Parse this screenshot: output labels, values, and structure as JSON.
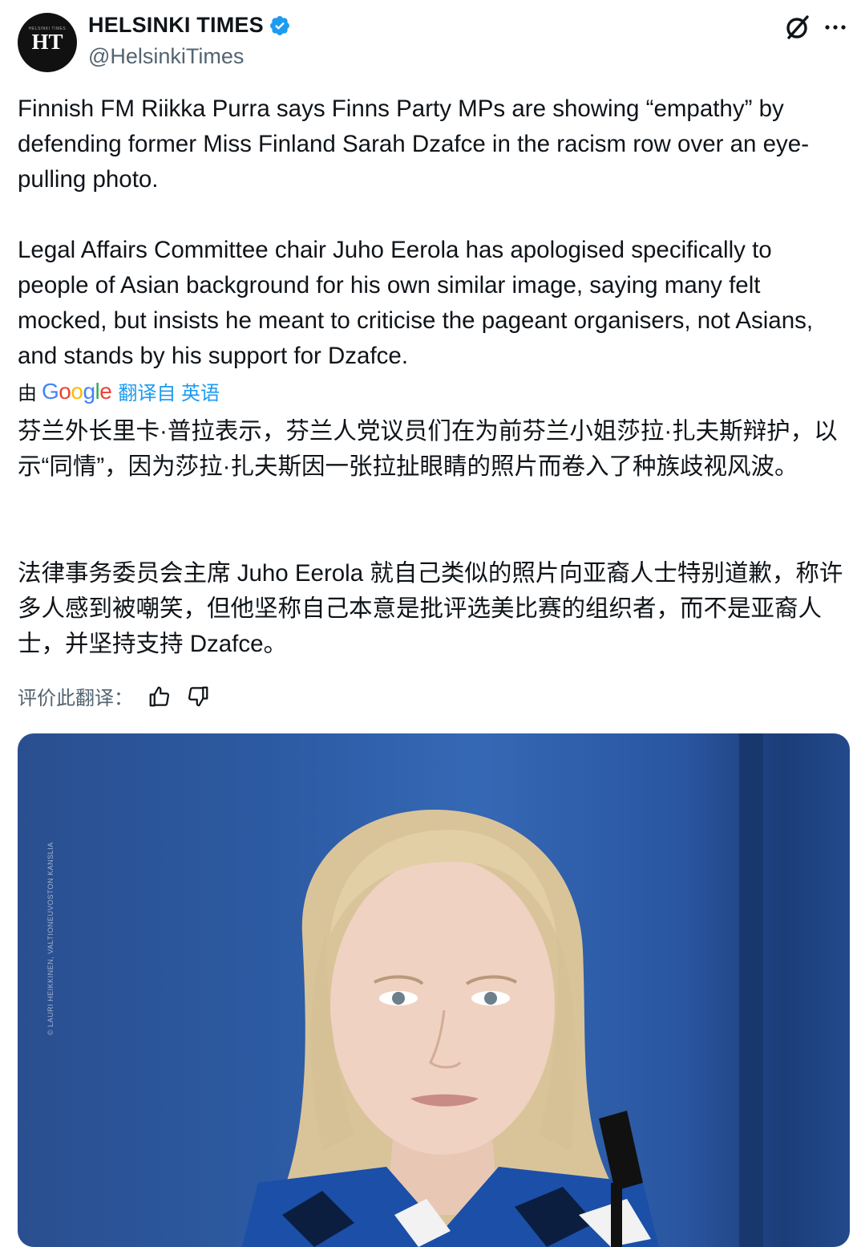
{
  "account": {
    "avatar_text": "HT",
    "avatar_small_text": "HELSINKI TIMES",
    "display_name": "HELSINKI TIMES",
    "handle": "@HelsinkiTimes",
    "verified_color": "#1d9bf0"
  },
  "post": {
    "paragraph_1": "Finnish FM Riikka Purra says Finns Party MPs are showing “empathy” by defending former Miss Finland Sarah Dzafce in the racism row over an eye-pulling photo.",
    "paragraph_2": "Legal Affairs Committee chair Juho Eerola has apologised specifically to people of Asian background for his own similar image, saying many felt mocked, but insists he meant to criticise the pageant organisers, not Asians, and stands by his support for Dzafce."
  },
  "translation": {
    "by_label": "由",
    "provider": "Google",
    "link_label": "翻译自 英语",
    "paragraph_1": "芬兰外长里卡·普拉表示，芬兰人党议员们在为前芬兰小姐莎拉·扎夫斯辩护，以示“同情”，因为莎拉·扎夫斯因一张拉扯眼睛的照片而卷入了种族歧视风波。",
    "paragraph_2": "法律事务委员会主席 Juho Eerola 就自己类似的照片向亚裔人士特别道歉，称许多人感到被嘲笑，但他坚称自己本意是批评选美比赛的组织者，而不是亚裔人士，并坚持支持 Dzafce。",
    "rate_label": "评价此翻译："
  },
  "media": {
    "photo_credit": "© LAURI HEIKKINEN, VALTIONEUVOSTON KANSLIA"
  },
  "icons": {
    "grok": "grok-icon",
    "more": "more-icon",
    "thumbs_up": "thumbs-up-icon",
    "thumbs_down": "thumbs-down-icon"
  },
  "colors": {
    "link": "#1d9bf0",
    "secondary_text": "#536471",
    "photo_background": "#2c5aa2"
  }
}
